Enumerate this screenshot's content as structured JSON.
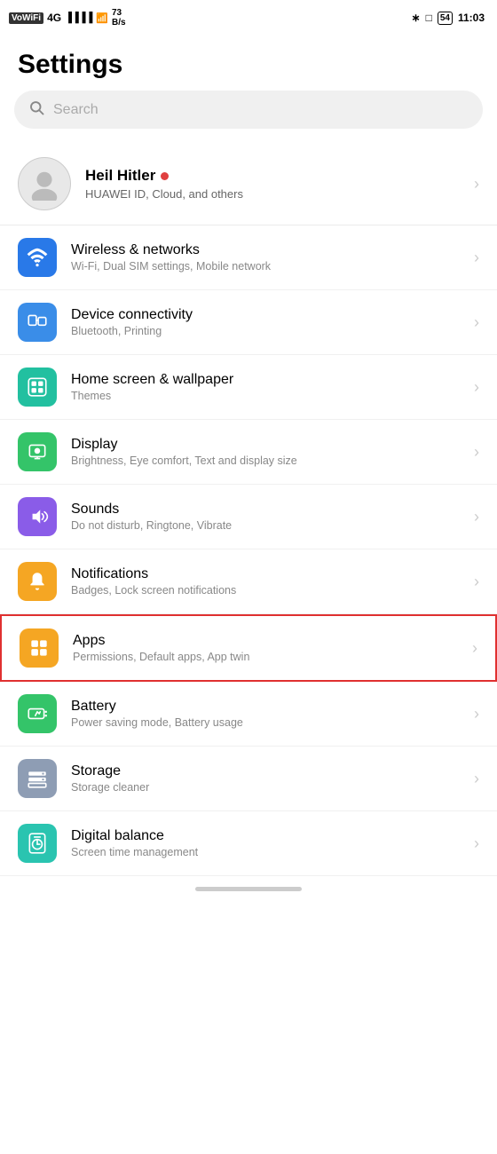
{
  "statusBar": {
    "left": {
      "wovifi": "VoWiFi",
      "signal": "4G",
      "bars": "||||",
      "wifi": "WiFi",
      "speed": "73 B/s"
    },
    "right": {
      "bluetooth": "BT",
      "sim": "SIM",
      "battery": "54",
      "time": "11:03"
    }
  },
  "pageTitle": "Settings",
  "search": {
    "placeholder": "Search"
  },
  "profile": {
    "name": "Heil Hitler",
    "subtitle": "HUAWEI ID, Cloud, and others"
  },
  "items": [
    {
      "id": "wireless",
      "title": "Wireless & networks",
      "subtitle": "Wi-Fi, Dual SIM settings, Mobile network",
      "iconColor": "icon-blue",
      "highlighted": false
    },
    {
      "id": "device-connectivity",
      "title": "Device connectivity",
      "subtitle": "Bluetooth, Printing",
      "iconColor": "icon-blue2",
      "highlighted": false
    },
    {
      "id": "home-screen",
      "title": "Home screen & wallpaper",
      "subtitle": "Themes",
      "iconColor": "icon-teal",
      "highlighted": false
    },
    {
      "id": "display",
      "title": "Display",
      "subtitle": "Brightness, Eye comfort, Text and display size",
      "iconColor": "icon-green2",
      "highlighted": false
    },
    {
      "id": "sounds",
      "title": "Sounds",
      "subtitle": "Do not disturb, Ringtone, Vibrate",
      "iconColor": "icon-purple",
      "highlighted": false
    },
    {
      "id": "notifications",
      "title": "Notifications",
      "subtitle": "Badges, Lock screen notifications",
      "iconColor": "icon-yellow",
      "highlighted": false
    },
    {
      "id": "apps",
      "title": "Apps",
      "subtitle": "Permissions, Default apps, App twin",
      "iconColor": "icon-orange",
      "highlighted": true
    },
    {
      "id": "battery",
      "title": "Battery",
      "subtitle": "Power saving mode, Battery usage",
      "iconColor": "icon-green",
      "highlighted": false
    },
    {
      "id": "storage",
      "title": "Storage",
      "subtitle": "Storage cleaner",
      "iconColor": "icon-gray",
      "highlighted": false
    },
    {
      "id": "digital-balance",
      "title": "Digital balance",
      "subtitle": "Screen time management",
      "iconColor": "icon-teal2",
      "highlighted": false
    }
  ]
}
